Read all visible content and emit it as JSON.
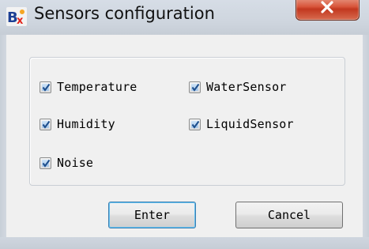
{
  "window": {
    "title": "Sensors configuration"
  },
  "sensors": [
    {
      "label": "Temperature",
      "checked": true
    },
    {
      "label": "WaterSensor",
      "checked": true
    },
    {
      "label": "Humidity",
      "checked": true
    },
    {
      "label": "LiquidSensor",
      "checked": true
    },
    {
      "label": "Noise",
      "checked": true
    }
  ],
  "buttons": {
    "enter_label": "Enter",
    "cancel_label": "Cancel"
  },
  "colors": {
    "close_button": "#d04a30",
    "check_fill": "#a4c6ea",
    "check_mark": "#1d4e8c",
    "default_button_border": "#3c7fb1"
  },
  "icons": {
    "app": "bx-app-icon",
    "close": "close-icon",
    "check": "checkmark-icon"
  }
}
